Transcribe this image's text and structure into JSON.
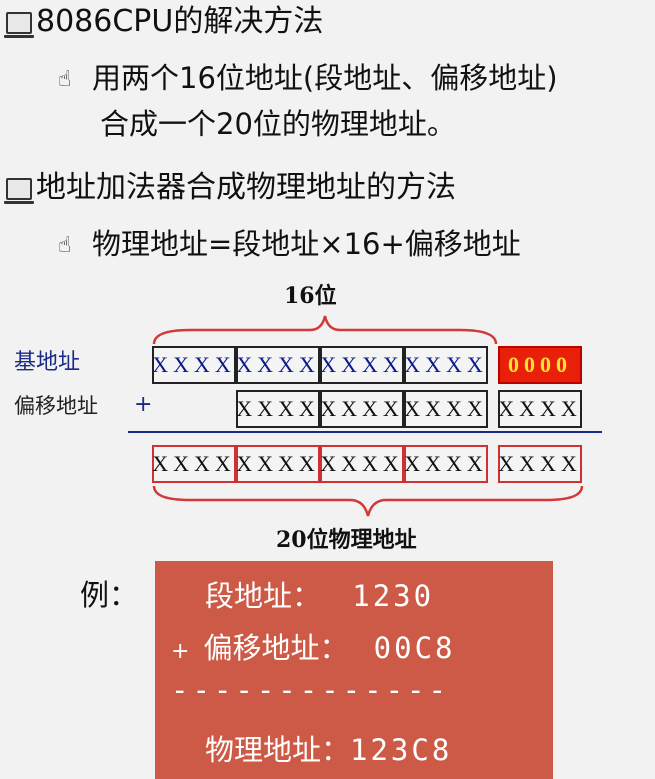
{
  "bullets": [
    {
      "icon": "laptop-icon",
      "text": "8086CPU的解决方法",
      "sub": {
        "icon": "hand-pointer-icon",
        "lines": [
          "用两个16位地址(段地址、偏移地址)",
          "合成一个20位的物理地址。"
        ]
      }
    },
    {
      "icon": "laptop-icon",
      "text": "地址加法器合成物理地址的方法",
      "sub": {
        "icon": "hand-pointer-icon",
        "lines": [
          "物理地址=段地址×16+偏移地址"
        ]
      }
    }
  ],
  "diagram": {
    "top_label": "16位",
    "base_label": "基地址",
    "offset_label": "偏移地址",
    "plus": "+",
    "bottom_label": "20位物理地址",
    "cell_text": "XXXX",
    "zero_text": "0000"
  },
  "example": {
    "label": "例：",
    "seg_label": "段地址：",
    "seg_value": "1230",
    "plus": "+",
    "off_label": "偏移地址：",
    "off_value": "00C8",
    "divider": "-------------",
    "phys_label": "物理地址：",
    "phys_value": "123C8"
  },
  "colors": {
    "background": "#f2f2f2",
    "example_box": "#cd5a46",
    "brace": "#d23a3a",
    "base_label": "#1a2a8a",
    "zero_cell": "#e8200a",
    "zero_text": "#ffe230"
  }
}
